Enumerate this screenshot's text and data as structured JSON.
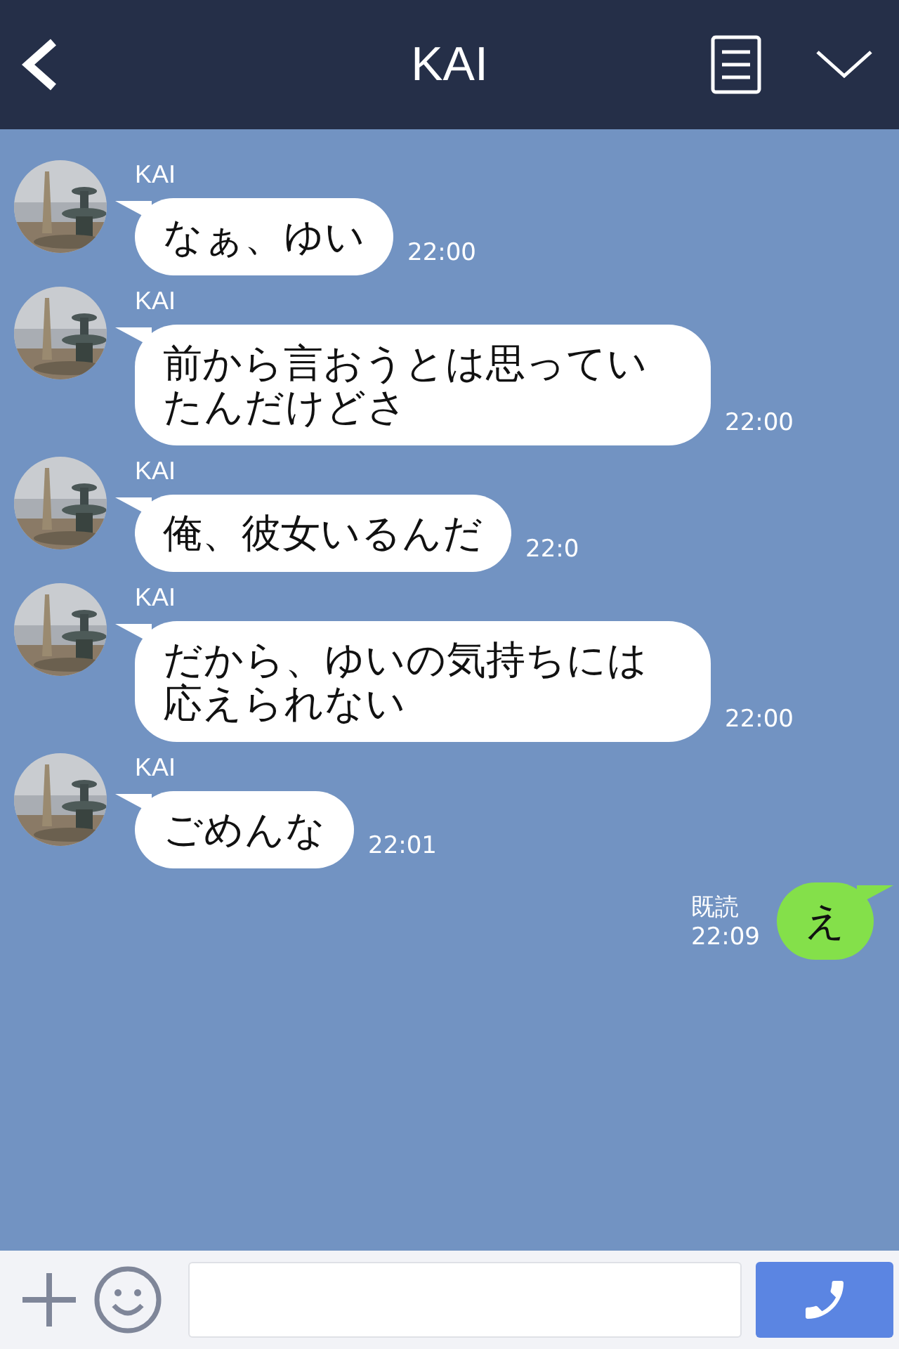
{
  "header": {
    "title": "KAI"
  },
  "messages": [
    {
      "kind": "received",
      "sender": "KAI",
      "text": "なぁ、ゆい",
      "time": "22:00"
    },
    {
      "kind": "received",
      "sender": "KAI",
      "text": "前から言おうとは思っていたんだけどさ",
      "time": "22:00"
    },
    {
      "kind": "received",
      "sender": "KAI",
      "text": "俺、彼女いるんだ",
      "time": "22:0"
    },
    {
      "kind": "received",
      "sender": "KAI",
      "text": "だから、ゆいの気持ちには応えられない",
      "time": "22:00"
    },
    {
      "kind": "received",
      "sender": "KAI",
      "text": "ごめんな",
      "time": "22:01"
    },
    {
      "kind": "sent",
      "text": "え",
      "read_label": "既読",
      "time": "22:09"
    }
  ]
}
